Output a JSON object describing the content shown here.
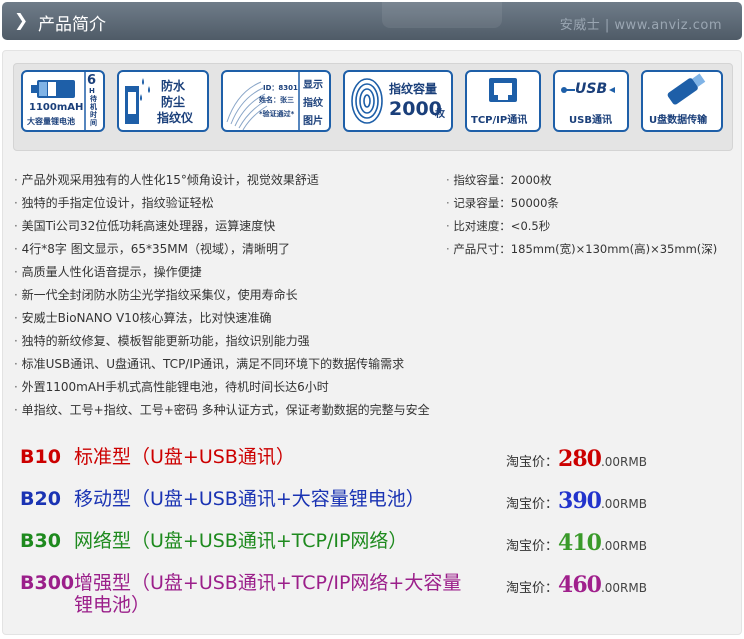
{
  "header": {
    "chevron": "❯",
    "title": "产品简介",
    "brand": "安威士 | www.anviz.com"
  },
  "icons": [
    {
      "name": "battery",
      "hours": "6",
      "unit": "H",
      "side": "待机时间",
      "capacity": "1100mAH",
      "caption": "大容量锂电池"
    },
    {
      "name": "waterproof",
      "lines": [
        "防水",
        "防尘",
        "指纹仪"
      ]
    },
    {
      "name": "display",
      "id_line": "ID：8301",
      "name_line": "姓名：张三",
      "verify_line": "*验证通过*",
      "side": [
        "显示",
        "指纹",
        "图片"
      ]
    },
    {
      "name": "capacity",
      "label": "指纹容量",
      "value": "2000",
      "unit": "枚"
    },
    {
      "name": "tcpip",
      "label": "TCP/IP通讯"
    },
    {
      "name": "usb",
      "logo": "USB",
      "label": "USB通讯"
    },
    {
      "name": "udisk",
      "label": "U盘数据传输"
    }
  ],
  "features_left": [
    "产品外观采用独有的人性化15°倾角设计，视觉效果舒适",
    "独特的手指定位设计，指纹验证轻松",
    "美国Ti公司32位低功耗高速处理器，运算速度快",
    "4行*8字 图文显示，65*35MM（视域），清晰明了",
    "高质量人性化语音提示，操作便捷",
    "新一代全封闭防水防尘光学指纹采集仪，使用寿命长",
    "安威士BioNANO V10核心算法，比对快速准确",
    "独特的新纹修复、模板智能更新功能，指纹识别能力强",
    "标准USB通讯、U盘通讯、TCP/IP通讯，满足不同环境下的数据传输需求",
    "外置1100mAH手机式高性能锂电池，待机时间长达6小时",
    "单指纹、工号+指纹、工号+密码 多种认证方式，保证考勤数据的完整与安全"
  ],
  "features_right": [
    "指纹容量：2000枚",
    "记录容量：50000条",
    "比对速度：<0.5秒",
    "产品尺寸：185mm(宽)×130mm(高)×35mm(深)"
  ],
  "products": [
    {
      "code": "B10",
      "name": "标准型（U盘+USB通讯）",
      "price_label": "淘宝价：",
      "price": "280",
      "price_suffix": ".00RMB",
      "code_color": "#cc0000",
      "name_color": "#cc0000",
      "price_color": "#cc0000"
    },
    {
      "code": "B20",
      "name": "移动型（U盘+USB通讯+大容量锂电池）",
      "price_label": "淘宝价：",
      "price": "390",
      "price_suffix": ".00RMB",
      "code_color": "#1a33b3",
      "name_color": "#1a33b3",
      "price_color": "#2233cc"
    },
    {
      "code": "B30",
      "name": "网络型（U盘+USB通讯+TCP/IP网络）",
      "price_label": "淘宝价：",
      "price": "410",
      "price_suffix": ".00RMB",
      "code_color": "#1e8a1e",
      "name_color": "#1e8a1e",
      "price_color": "#3a9a2a"
    },
    {
      "code": "B300",
      "name": "增强型（U盘+USB通讯+TCP/IP网络+大容量锂电池）",
      "price_label": "淘宝价：",
      "price": "460",
      "price_suffix": ".00RMB",
      "code_color": "#9b1f8a",
      "name_color": "#9b1f8a",
      "price_color": "#a0208c"
    }
  ]
}
